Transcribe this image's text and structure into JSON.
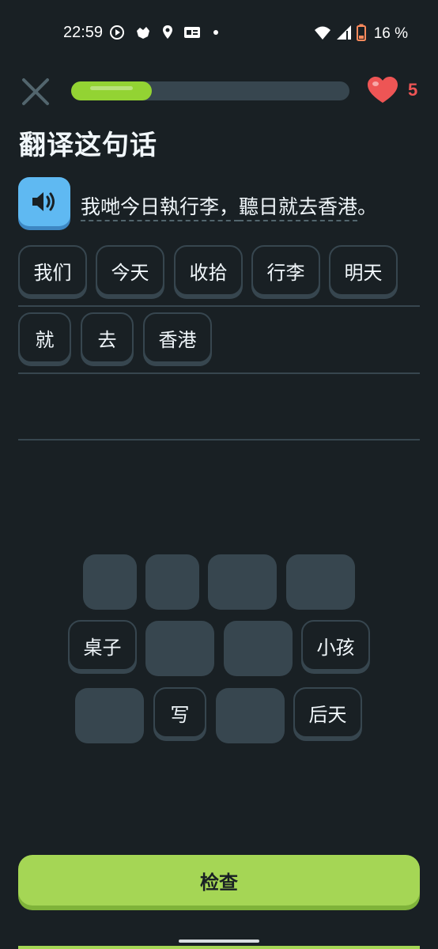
{
  "status_bar": {
    "time": "22:59",
    "battery_percent": "16 %",
    "icons": [
      "play-circle-icon",
      "app-notification-icon",
      "location-pin-icon",
      "id-card-icon",
      "dot-icon",
      "wifi-icon",
      "cell-signal-icon",
      "battery-low-icon"
    ]
  },
  "top_bar": {
    "progress_fraction": 0.29,
    "hearts_count": "5"
  },
  "title": "翻译这句话",
  "prompt": {
    "segment_1": "我哋今日執行李，",
    "segment_2": "聽日就去香港",
    "end_punct": "。"
  },
  "answer_tiles": {
    "row_1": [
      "我们",
      "今天",
      "收拾",
      "行李",
      "明天"
    ],
    "row_2": [
      "就",
      "去",
      "香港"
    ]
  },
  "word_bank": {
    "row_2_left": "桌子",
    "row_2_right": "小孩",
    "row_3_mid": "写",
    "row_3_right": "后天"
  },
  "check_button_label": "检查",
  "colors": {
    "background": "#192024",
    "accent_green": "#a5d655",
    "progress_green": "#93d333",
    "heart_red": "#ee5555",
    "speaker_blue": "#5fb9f2",
    "tile_border": "#37464f"
  }
}
